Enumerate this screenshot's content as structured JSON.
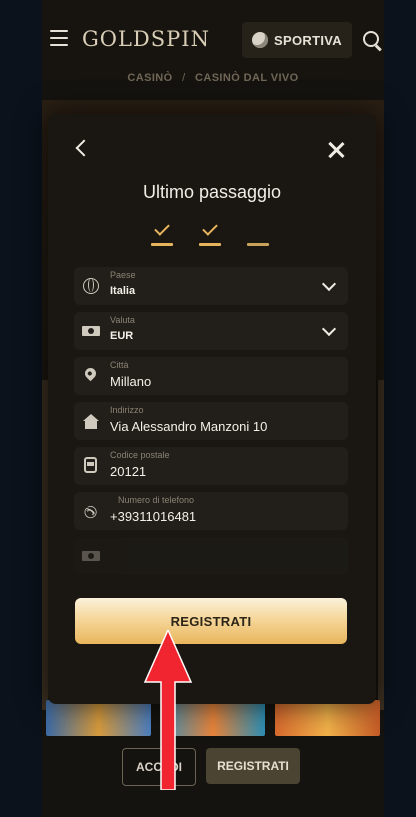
{
  "header": {
    "logo_text": "GOLDSPIN",
    "sport_button_label": "SPORTIVA",
    "menu_icon": "hamburger-icon",
    "search_icon": "search-icon"
  },
  "breadcrumb": {
    "items": [
      "CASINÒ",
      "CASINÒ DAL VIVO"
    ],
    "separator": "/"
  },
  "modal": {
    "title": "Ultimo passaggio",
    "steps": [
      {
        "state": "done"
      },
      {
        "state": "done"
      },
      {
        "state": "pending"
      }
    ],
    "fields": [
      {
        "label": "Paese",
        "value": "Italia",
        "icon": "globe-icon",
        "type": "select"
      },
      {
        "label": "Valuta",
        "value": "EUR",
        "icon": "banknote-icon",
        "type": "select"
      },
      {
        "label": "Città",
        "value": "Millano",
        "icon": "location-pin-icon",
        "type": "text"
      },
      {
        "label": "Indirizzo",
        "value": "Via Alessandro Manzoni 10",
        "icon": "house-icon",
        "type": "text"
      },
      {
        "label": "Codice postale",
        "value": "20121",
        "icon": "bus-icon",
        "type": "text"
      },
      {
        "label": "Numero di telefono",
        "value": "+39311016481",
        "icon": "phone-icon",
        "type": "text"
      }
    ],
    "register_label": "REGISTRATI"
  },
  "footer": {
    "login_label": "ACCEDI",
    "register_label": "REGISTRATI"
  },
  "colors": {
    "accent_gold": "#e6b45d",
    "annotation_arrow": "#f0252f"
  }
}
